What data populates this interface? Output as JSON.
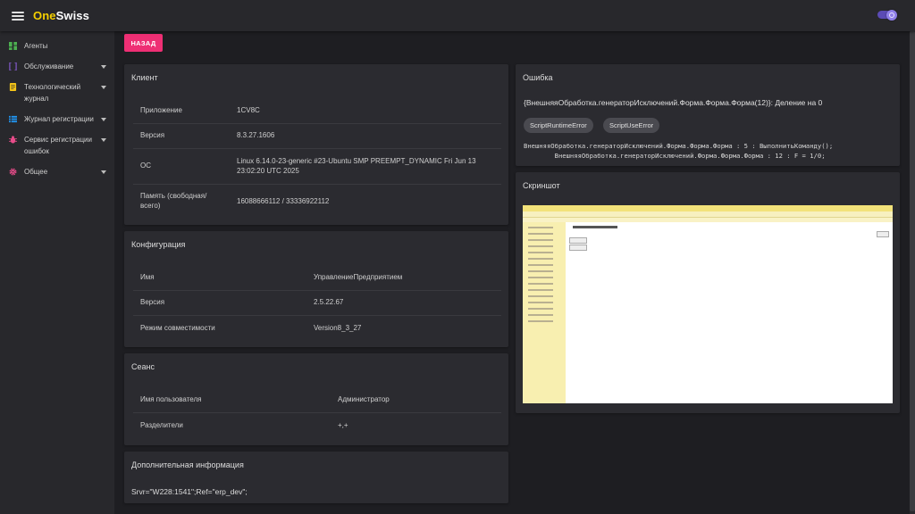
{
  "app": {
    "logo_part1": "One",
    "logo_part2": "Swiss"
  },
  "sidebar": {
    "items": [
      {
        "label": "Агенты",
        "icon": "dashboard-icon",
        "color": "#4caf50",
        "expandable": false
      },
      {
        "label": "Обслуживание",
        "icon": "brackets-icon",
        "color": "#7e57c2",
        "expandable": true
      },
      {
        "label": "Технологический журнал",
        "icon": "document-icon",
        "color": "#f5c518",
        "expandable": true
      },
      {
        "label": "Журнал регистрации",
        "icon": "list-icon",
        "color": "#2196f3",
        "expandable": true
      },
      {
        "label": "Сервис регистрации ошибок",
        "icon": "bug-icon",
        "color": "#e84c8a",
        "expandable": true
      },
      {
        "label": "Общее",
        "icon": "gear-icon",
        "color": "#e84c8a",
        "expandable": true
      }
    ]
  },
  "back_button": "НАЗАД",
  "client": {
    "title": "Клиент",
    "rows": [
      {
        "label": "Приложение",
        "value": "1CV8C"
      },
      {
        "label": "Версия",
        "value": "8.3.27.1606"
      },
      {
        "label": "ОС",
        "value": "Linux 6.14.0-23-generic #23-Ubuntu SMP PREEMPT_DYNAMIC Fri Jun 13 23:02:20 UTC 2025"
      },
      {
        "label": "Память (свободная/всего)",
        "value": "16088666112 / 33336922112"
      }
    ]
  },
  "config": {
    "title": "Конфигурация",
    "rows": [
      {
        "label": "Имя",
        "value": "УправлениеПредприятием"
      },
      {
        "label": "Версия",
        "value": "2.5.22.67"
      },
      {
        "label": "Режим совместимости",
        "value": "Version8_3_27"
      }
    ]
  },
  "session": {
    "title": "Сеанс",
    "rows": [
      {
        "label": "Имя пользователя",
        "value": "Администратор"
      },
      {
        "label": "Разделители",
        "value": "+,+"
      }
    ]
  },
  "additional": {
    "title": "Дополнительная информация",
    "text": "Srvr=\"W228:1541\";Ref=\"erp_dev\";"
  },
  "error": {
    "title": "Ошибка",
    "message": "{ВнешняяОбработка.генераторИсключений.Форма.Форма.Форма(12)}: Деление на 0",
    "chips": [
      "ScriptRuntimeError",
      "ScriptUseError"
    ],
    "stack_line1": "ВнешняяОбработка.генераторИсключений.Форма.Форма.Форма : 5 : ВыполнитьКоманду();",
    "stack_line2": "        ВнешняяОбработка.генераторИсключений.Форма.Форма.Форма : 12 : F = 1/0;"
  },
  "screenshot": {
    "title": "Скриншот"
  }
}
